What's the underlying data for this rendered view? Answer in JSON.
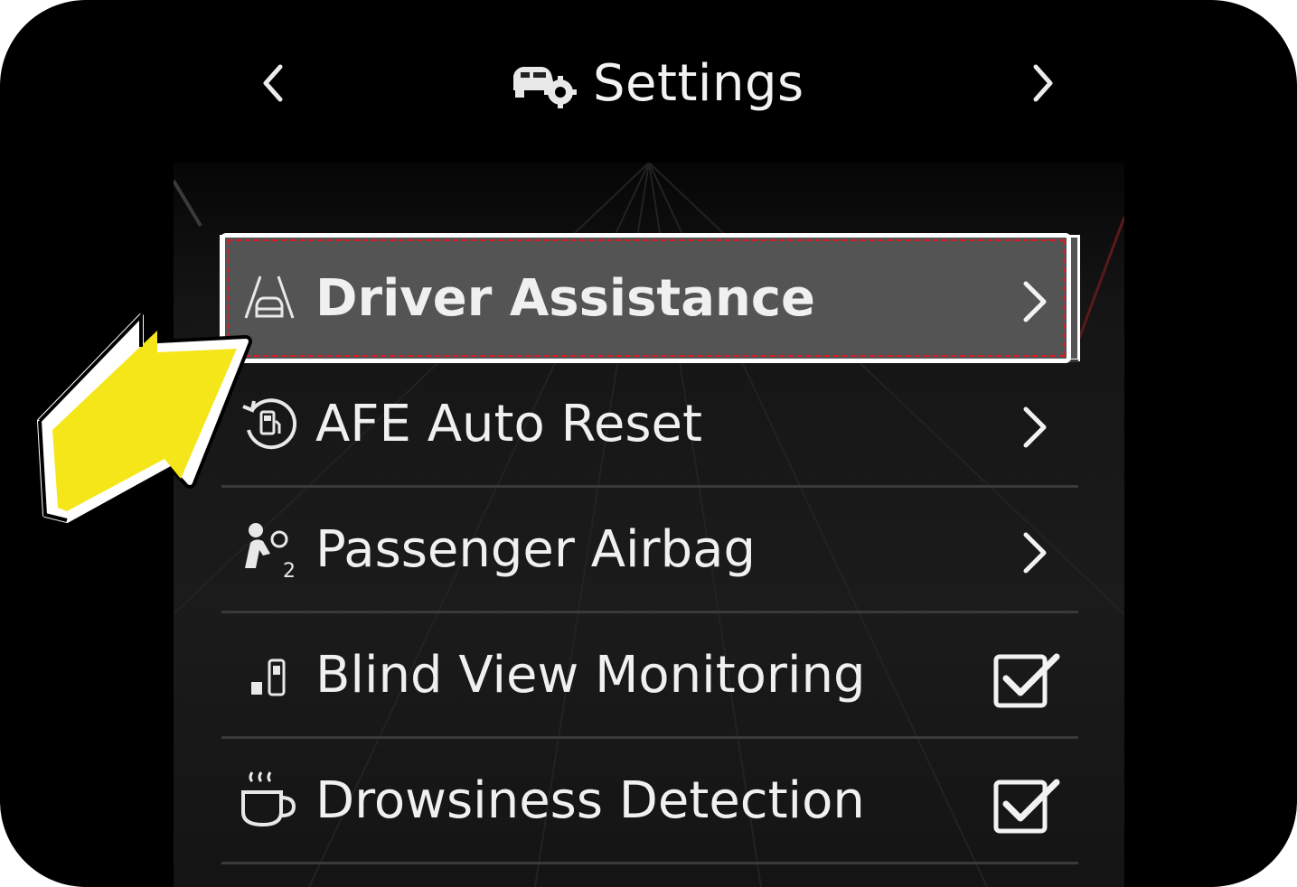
{
  "header": {
    "title": "Settings",
    "icon": "car-settings-icon",
    "prev_icon": "chevron-left-icon",
    "next_icon": "chevron-right-icon"
  },
  "menu": {
    "items": [
      {
        "label": "Driver Assistance",
        "icon": "lane-car-icon",
        "trailing": "chevron-right-icon",
        "selected": true
      },
      {
        "label": "AFE Auto Reset",
        "icon": "fuel-reset-icon",
        "trailing": "chevron-right-icon",
        "selected": false
      },
      {
        "label": "Passenger Airbag",
        "icon": "passenger-airbag-icon",
        "trailing": "chevron-right-icon",
        "selected": false
      },
      {
        "label": "Blind View Monitoring",
        "icon": "blind-view-icon",
        "trailing": "checkbox",
        "checked": true
      },
      {
        "label": "Drowsiness Detection",
        "icon": "coffee-cup-icon",
        "trailing": "checkbox",
        "checked": true
      }
    ]
  },
  "colors": {
    "background": "#000000",
    "selected_row": "#545454",
    "highlight_dash": "#e01b24",
    "callout_arrow": "#f5e61a",
    "text": "#f0f0f0"
  }
}
